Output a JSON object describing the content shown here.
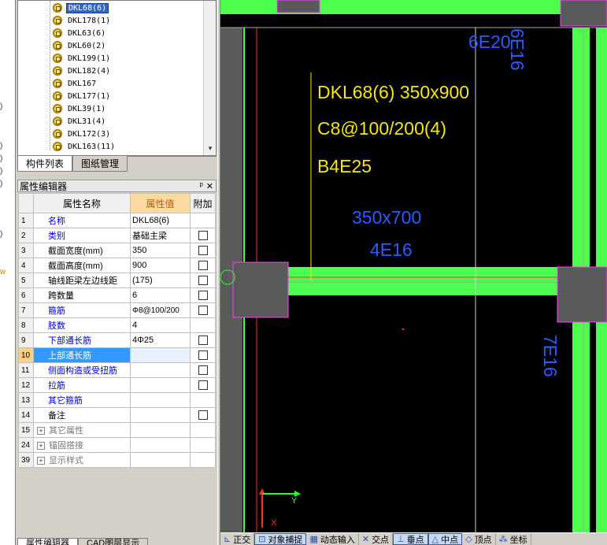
{
  "tree": {
    "items": [
      "DKL68(6)",
      "DKL178(1)",
      "DKL63(6)",
      "DKL60(2)",
      "DKL199(1)",
      "DKL182(4)",
      "DKL167",
      "DKL177(1)",
      "DKL39(1)",
      "DKL31(4)",
      "DKL172(3)",
      "DKL163(11)"
    ],
    "selected_index": 0
  },
  "tabs_top": [
    "构件列表",
    "图纸管理"
  ],
  "prop_editor": {
    "title": "属性编辑器",
    "pin_icon": "pin-icon",
    "close_icon": "close-icon",
    "headers": {
      "num": "",
      "name": "属性名称",
      "value": "属性值",
      "extra": "附加"
    },
    "rows": [
      {
        "num": "1",
        "name": "名称",
        "value": "DKL68(6)",
        "blue": true,
        "checkbox": false
      },
      {
        "num": "2",
        "name": "类别",
        "value": "基础主梁",
        "blue": true,
        "checkbox": true
      },
      {
        "num": "3",
        "name": "截面宽度(mm)",
        "value": "350",
        "blue": false,
        "checkbox": true
      },
      {
        "num": "4",
        "name": "截面高度(mm)",
        "value": "900",
        "blue": false,
        "checkbox": true
      },
      {
        "num": "5",
        "name": "轴线距梁左边线距",
        "value": "(175)",
        "blue": false,
        "checkbox": true
      },
      {
        "num": "6",
        "name": "跨数量",
        "value": "6",
        "blue": false,
        "checkbox": true
      },
      {
        "num": "7",
        "name": "箍筋",
        "value": "Φ8@100/200",
        "blue": true,
        "checkbox": true
      },
      {
        "num": "8",
        "name": "肢数",
        "value": "4",
        "blue": true,
        "checkbox": false
      },
      {
        "num": "9",
        "name": "下部通长筋",
        "value": "4Φ25",
        "blue": true,
        "checkbox": true
      },
      {
        "num": "10",
        "name": "上部通长筋",
        "value": "",
        "blue": true,
        "checkbox": true,
        "selected": true
      },
      {
        "num": "11",
        "name": "侧面构造或受扭筋",
        "value": "",
        "blue": true,
        "checkbox": true
      },
      {
        "num": "12",
        "name": "拉筋",
        "value": "",
        "blue": true,
        "checkbox": true
      },
      {
        "num": "13",
        "name": "其它箍筋",
        "value": "",
        "blue": true,
        "checkbox": false
      },
      {
        "num": "14",
        "name": "备注",
        "value": "",
        "blue": false,
        "checkbox": true
      },
      {
        "num": "15",
        "name": "其它属性",
        "value": "",
        "group": true
      },
      {
        "num": "24",
        "name": "锚固搭接",
        "value": "",
        "group": true
      },
      {
        "num": "39",
        "name": "显示样式",
        "value": "",
        "group": true
      }
    ]
  },
  "tabs_bottom": [
    "属性编辑器",
    "CAD图层显示"
  ],
  "cad": {
    "beam_line1": "DKL68(6) 350x900",
    "beam_line2": "C8@100/200(4)",
    "beam_line3": "B4E25",
    "top_rebar": "6E20",
    "side_rebar_top": "6E16",
    "section_label": "350x700",
    "bottom_rebar": "4E16",
    "right_rebar": "7E16",
    "axis_y": "Y",
    "axis_x": "X",
    "colors": {
      "background": "#000000",
      "beam": "#4cff4c",
      "column": "#5a5a5a",
      "annotation": "#f5e614",
      "label": "#2a5cff"
    }
  },
  "status_bar": {
    "items": [
      {
        "icon": "ortho-icon",
        "label": "正交",
        "on": false
      },
      {
        "icon": "snap-icon",
        "label": "对象捕捉",
        "on": true
      },
      {
        "icon": "dynamic-input-icon",
        "label": "动态输入",
        "on": false
      },
      {
        "icon": "intersection-icon",
        "label": "交点",
        "on": false
      },
      {
        "icon": "perpendicular-icon",
        "label": "垂点",
        "on": true
      },
      {
        "icon": "midpoint-icon",
        "label": "中点",
        "on": true
      },
      {
        "icon": "vertex-icon",
        "label": "顶点",
        "on": false
      },
      {
        "icon": "coordinate-icon",
        "label": "坐标",
        "on": false
      }
    ]
  }
}
